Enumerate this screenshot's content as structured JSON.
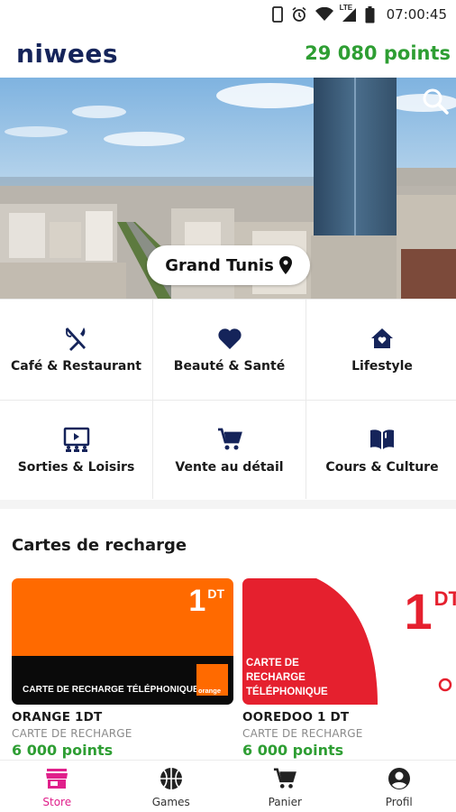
{
  "status_bar": {
    "time": "07:00:45",
    "network": "LTE"
  },
  "header": {
    "logo": "niwees",
    "points": "29 080 points"
  },
  "hero": {
    "city": "Grand Tunis"
  },
  "categories": [
    {
      "label": "Café & Restaurant",
      "icon": "fork-knife-icon"
    },
    {
      "label": "Beauté & Santé",
      "icon": "heart-icon"
    },
    {
      "label": "Lifestyle",
      "icon": "home-heart-icon"
    },
    {
      "label": "Sorties & Loisirs",
      "icon": "presentation-icon"
    },
    {
      "label": "Vente au détail",
      "icon": "cart-icon"
    },
    {
      "label": "Cours & Culture",
      "icon": "book-icon"
    }
  ],
  "section": {
    "title": "Cartes de recharge"
  },
  "cards": [
    {
      "name": "ORANGE 1DT",
      "subtitle": "CARTE DE RECHARGE",
      "points": "6 000 points",
      "amount": "1",
      "unit": "DT",
      "caption": "CARTE DE RECHARGE TÉLÉPHONIQUE",
      "brand": "orange",
      "color": "#ff6a00"
    },
    {
      "name": "OOREDOO 1 DT",
      "subtitle": "CARTE DE RECHARGE",
      "points": "6 000 points",
      "amount": "1",
      "unit": "DT",
      "caption_lines": [
        "CARTE DE",
        "RECHARGE",
        "TÉLÉPHONIQUE"
      ],
      "color": "#e5202e"
    }
  ],
  "nav": {
    "items": [
      {
        "label": "Store",
        "icon": "store-icon",
        "active": true
      },
      {
        "label": "Games",
        "icon": "basketball-icon",
        "active": false
      },
      {
        "label": "Panier",
        "icon": "cart-icon",
        "active": false
      },
      {
        "label": "Profil",
        "icon": "account-icon",
        "active": false
      }
    ],
    "active_color": "#e0208b"
  },
  "colors": {
    "brand_navy": "#15245a",
    "points_green": "#2e9e33",
    "accent_pink": "#e0208b"
  }
}
